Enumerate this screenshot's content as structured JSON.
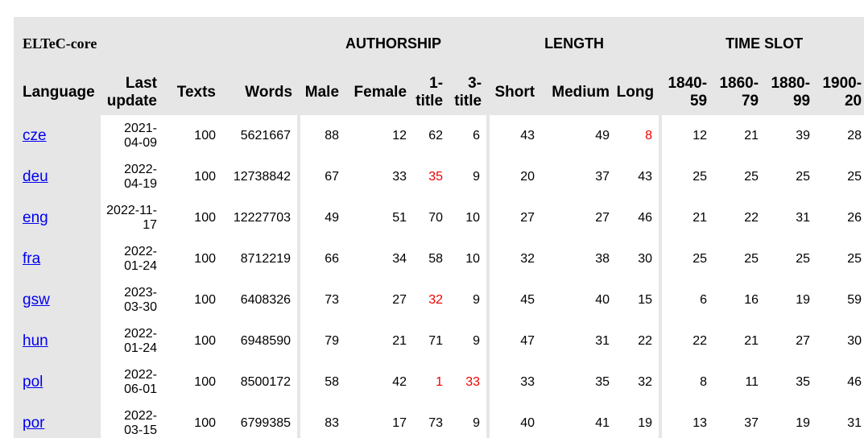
{
  "table": {
    "title": "ELTeC-core",
    "groups": {
      "authorship": "AUTHORSHIP",
      "length": "LENGTH",
      "time_slot": "TIME SLOT"
    },
    "headers": [
      "Language",
      "Last update",
      "Texts",
      "Words",
      "Male",
      "Female",
      "1-title",
      "3-title",
      "Short",
      "Medium",
      "Long",
      "1840-59",
      "1860-79",
      "1880-99",
      "1900-20"
    ],
    "rows": [
      {
        "lang": "cze",
        "date1": "2021-",
        "date2": "04-09",
        "texts": "100",
        "words": "5621667",
        "male": "88",
        "female": "12",
        "t1": "62",
        "t3": "6",
        "short": "43",
        "medium": "49",
        "long": "8",
        "ts1": "12",
        "ts2": "21",
        "ts3": "39",
        "ts4": "28"
      },
      {
        "lang": "deu",
        "date1": "2022-",
        "date2": "04-19",
        "texts": "100",
        "words": "12738842",
        "male": "67",
        "female": "33",
        "t1": "35",
        "t3": "9",
        "short": "20",
        "medium": "37",
        "long": "43",
        "ts1": "25",
        "ts2": "25",
        "ts3": "25",
        "ts4": "25"
      },
      {
        "lang": "eng",
        "date1": "2022-11-",
        "date2": "17",
        "texts": "100",
        "words": "12227703",
        "male": "49",
        "female": "51",
        "t1": "70",
        "t3": "10",
        "short": "27",
        "medium": "27",
        "long": "46",
        "ts1": "21",
        "ts2": "22",
        "ts3": "31",
        "ts4": "26"
      },
      {
        "lang": "fra",
        "date1": "2022-",
        "date2": "01-24",
        "texts": "100",
        "words": "8712219",
        "male": "66",
        "female": "34",
        "t1": "58",
        "t3": "10",
        "short": "32",
        "medium": "38",
        "long": "30",
        "ts1": "25",
        "ts2": "25",
        "ts3": "25",
        "ts4": "25"
      },
      {
        "lang": "gsw",
        "date1": "2023-",
        "date2": "03-30",
        "texts": "100",
        "words": "6408326",
        "male": "73",
        "female": "27",
        "t1": "32",
        "t3": "9",
        "short": "45",
        "medium": "40",
        "long": "15",
        "ts1": "6",
        "ts2": "16",
        "ts3": "19",
        "ts4": "59"
      },
      {
        "lang": "hun",
        "date1": "2022-",
        "date2": "01-24",
        "texts": "100",
        "words": "6948590",
        "male": "79",
        "female": "21",
        "t1": "71",
        "t3": "9",
        "short": "47",
        "medium": "31",
        "long": "22",
        "ts1": "22",
        "ts2": "21",
        "ts3": "27",
        "ts4": "30"
      },
      {
        "lang": "pol",
        "date1": "2022-",
        "date2": "06-01",
        "texts": "100",
        "words": "8500172",
        "male": "58",
        "female": "42",
        "t1": "1",
        "t3": "33",
        "short": "33",
        "medium": "35",
        "long": "32",
        "ts1": "8",
        "ts2": "11",
        "ts3": "35",
        "ts4": "46"
      },
      {
        "lang": "por",
        "date1": "2022-",
        "date2": "03-15",
        "texts": "100",
        "words": "6799385",
        "male": "83",
        "female": "17",
        "t1": "73",
        "t3": "9",
        "short": "40",
        "medium": "41",
        "long": "19",
        "ts1": "13",
        "ts2": "37",
        "ts3": "19",
        "ts4": "31"
      }
    ],
    "highlight_color": "#ee0000"
  }
}
